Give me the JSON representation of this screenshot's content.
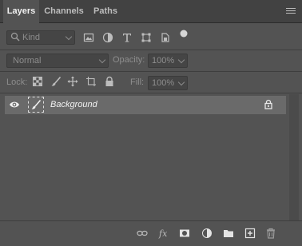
{
  "tabs": [
    {
      "label": "Layers"
    },
    {
      "label": "Channels"
    },
    {
      "label": "Paths"
    }
  ],
  "filter": {
    "kind_label": "Kind",
    "icons": [
      "image-filter-icon",
      "adjustment-filter-icon",
      "type-filter-icon",
      "shape-filter-icon",
      "smart-object-filter-icon",
      "filter-toggle-dot"
    ]
  },
  "blend": {
    "mode": "Normal",
    "opacity_label": "Opacity:",
    "opacity_value": "100%"
  },
  "lock": {
    "label": "Lock:",
    "fill_label": "Fill:",
    "fill_value": "100%",
    "icons": [
      "lock-transparent-pixels-icon",
      "lock-image-pixels-icon",
      "lock-position-icon",
      "lock-artboard-icon",
      "lock-all-icon"
    ]
  },
  "layers": [
    {
      "name": "Background",
      "visible": true,
      "locked": true
    }
  ],
  "bottom_icons": [
    "link-layers-icon",
    "fx-icon",
    "add-mask-icon",
    "adjustment-layer-icon",
    "new-group-icon",
    "new-layer-icon",
    "delete-layer-icon"
  ],
  "colors": {
    "panel": "#535353",
    "tabbar": "#424242",
    "selected_row": "#6a6a6a"
  }
}
